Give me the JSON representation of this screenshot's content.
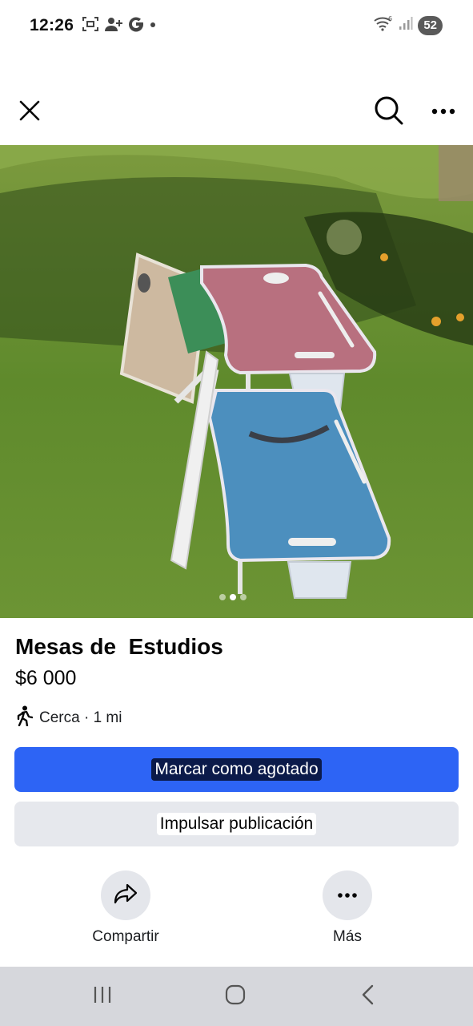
{
  "status_bar": {
    "time": "12:26",
    "left_icons": [
      "screenshot-icon",
      "person-add-icon",
      "google-g-icon",
      "dot-icon"
    ],
    "right_icons": [
      "wifi-icon",
      "signal-icon"
    ],
    "battery": "52"
  },
  "top_bar": {
    "icons": [
      "close-icon",
      "search-icon",
      "more-icon"
    ]
  },
  "photo": {
    "description_icon": "product-photo",
    "dot_count": 3,
    "active_dot": 1
  },
  "listing": {
    "title": "Mesas de  Estudios",
    "price": "$6 000",
    "distance": "Cerca · 1 mi"
  },
  "buttons": {
    "primary_label": "Marcar como agotado",
    "secondary_label": "Impulsar publicación"
  },
  "actions": {
    "share_label": "Compartir",
    "more_label": "Más"
  },
  "colors": {
    "primary": "#2d64f5",
    "secondary_bg": "#e6e8ed",
    "nav_bg": "#d6d7dc"
  }
}
